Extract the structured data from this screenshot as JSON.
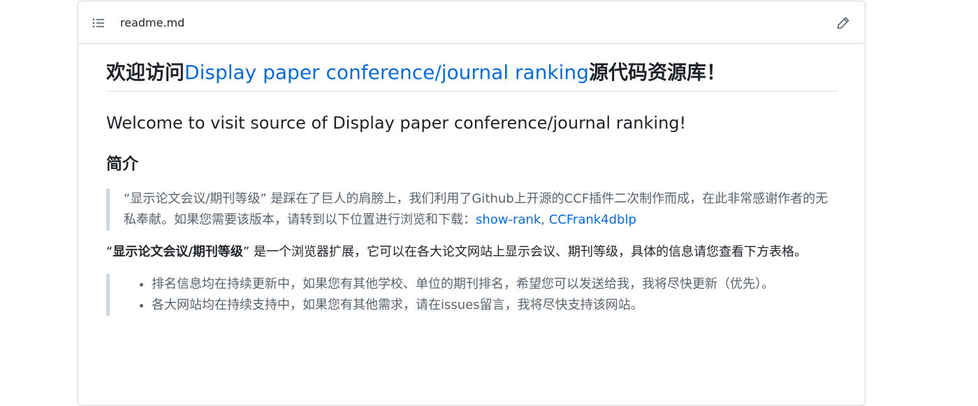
{
  "header": {
    "file_name": "readme.md",
    "toc_icon": "list-unordered-icon",
    "edit_icon": "pencil-icon"
  },
  "title": {
    "prefix": "欢迎访问",
    "link": "Display paper conference/journal ranking",
    "suffix": "源代码资源库！"
  },
  "subtitle": "Welcome to visit source of Display paper conference/journal ranking!",
  "section_heading": "简介",
  "intro_quote": {
    "text": "“显示论文会议/期刊等级” 是踩在了巨人的肩膀上，我们利用了Github上开源的CCF插件二次制作而成，在此非常感谢作者的无私奉献。如果您需要该版本，请转到以下位置进行浏览和下载：",
    "link1": "show-rank",
    "separator": ", ",
    "link2": "CCFrank4dblp"
  },
  "description": {
    "open_quote": "“",
    "bold": "显示论文会议/期刊等级",
    "rest": "” 是一个浏览器扩展，它可以在各大论文网站上显示会议、期刊等级，具体的信息请您查看下方表格。"
  },
  "notes": [
    "排名信息均在持续更新中，如果您有其他学校、单位的期刊排名，希望您可以发送给我，我将尽快更新（优先）。",
    "各大网站均在持续支持中，如果您有其他需求，请在issues留言，我将尽快支持该网站。"
  ],
  "colors": {
    "link": "#0969da",
    "border": "#d0d7de",
    "muted_text": "#59636e",
    "text": "#1f2328"
  }
}
